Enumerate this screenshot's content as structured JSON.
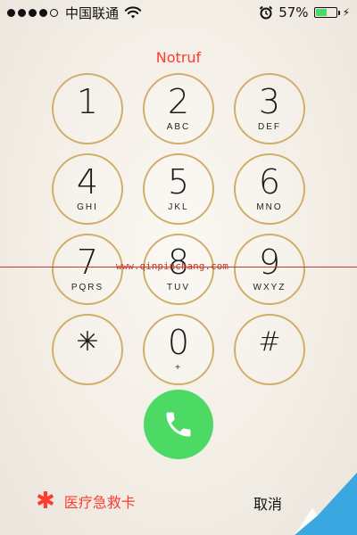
{
  "status_bar": {
    "signal_dots": [
      true,
      true,
      true,
      true,
      false
    ],
    "carrier": "中国联通",
    "battery_percent_text": "57%",
    "battery_level": 0.57,
    "wifi_icon": "wifi-icon",
    "alarm_icon": "alarm-icon",
    "charging_icon": "bolt-icon"
  },
  "title": "Notruf",
  "keys": [
    {
      "digit": "1",
      "letters": ""
    },
    {
      "digit": "2",
      "letters": "ABC"
    },
    {
      "digit": "3",
      "letters": "DEF"
    },
    {
      "digit": "4",
      "letters": "GHI"
    },
    {
      "digit": "5",
      "letters": "JKL"
    },
    {
      "digit": "6",
      "letters": "MNO"
    },
    {
      "digit": "7",
      "letters": "PQRS"
    },
    {
      "digit": "8",
      "letters": "TUV"
    },
    {
      "digit": "9",
      "letters": "WXYZ"
    },
    {
      "digit": "✳",
      "letters": ""
    },
    {
      "digit": "0",
      "letters": "+"
    },
    {
      "digit": "#",
      "letters": ""
    }
  ],
  "watermark": "www.qinpinchang.com",
  "call_button": {
    "icon": "phone-icon"
  },
  "bottom": {
    "emergency_icon": "✱",
    "emergency_label": "医疗急救卡",
    "cancel_label": "取消"
  },
  "colors": {
    "accent_red": "#ff3b30",
    "call_green": "#4cd964",
    "key_ring_gold": "#cfae6a"
  }
}
